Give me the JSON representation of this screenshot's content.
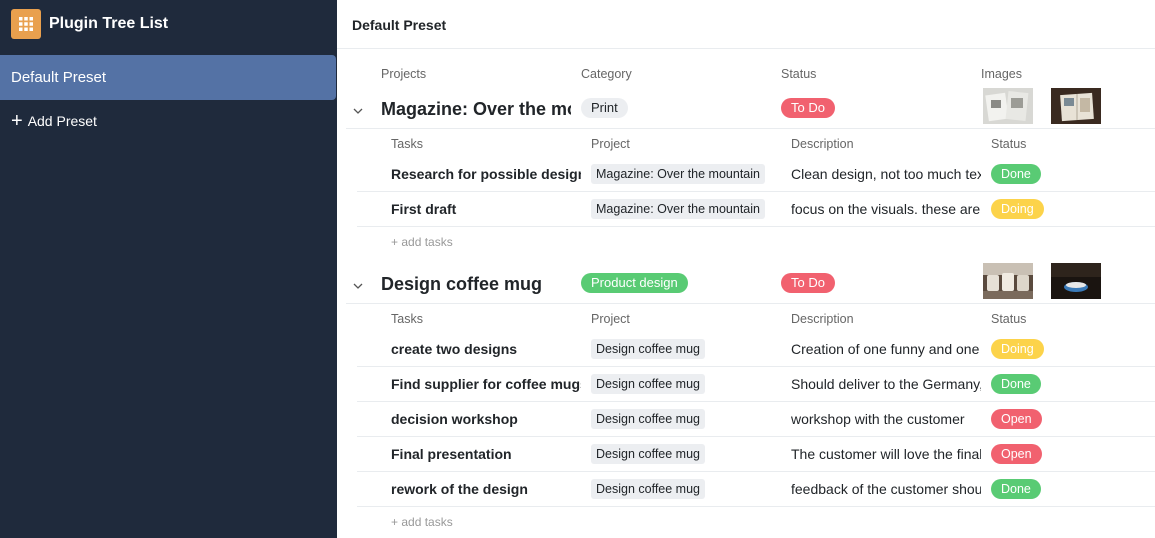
{
  "app": {
    "title": "Plugin Tree List",
    "logo_icon": "grid-icon",
    "logo_color": "#e9a04e"
  },
  "sidebar": {
    "presets": [
      {
        "label": "Default Preset",
        "active": true
      }
    ],
    "add_preset_label": "Add Preset"
  },
  "main": {
    "title": "Default Preset",
    "project_columns": [
      "Projects",
      "Category",
      "Status",
      "Images"
    ],
    "task_columns": [
      "Tasks",
      "Project",
      "Description",
      "Status"
    ],
    "add_tasks_label": "+ add tasks"
  },
  "colors": {
    "done": "#59cb74",
    "doing": "#fcd34a",
    "open": "#f1616f",
    "todo": "#f1616f",
    "print_bg": "#eceef1",
    "product_design": "#59cb74"
  },
  "projects": [
    {
      "name": "Magazine: Over the mountain",
      "category": "Print",
      "status": "To Do",
      "tasks": [
        {
          "name": "Research for possible designs",
          "project": "Magazine: Over the mountain",
          "description": "Clean design, not too much text",
          "status": "Done"
        },
        {
          "name": "First draft",
          "project": "Magazine: Over the mountain",
          "description": "focus on the visuals. these are",
          "status": "Doing"
        }
      ]
    },
    {
      "name": "Design coffee mug",
      "category": "Product design",
      "status": "To Do",
      "tasks": [
        {
          "name": "create two designs",
          "project": "Design coffee mug",
          "description": "Creation of one funny and one",
          "status": "Doing"
        },
        {
          "name": "Find supplier for coffee mugs",
          "project": "Design coffee mug",
          "description": "Should deliver to the Germany,",
          "status": "Done"
        },
        {
          "name": "decision workshop",
          "project": "Design coffee mug",
          "description": "workshop with the customer",
          "status": "Open"
        },
        {
          "name": "Final presentation",
          "project": "Design coffee mug",
          "description": "The customer will love the final",
          "status": "Open"
        },
        {
          "name": "rework of the design",
          "project": "Design coffee mug",
          "description": "feedback of the customer should",
          "status": "Done"
        }
      ]
    }
  ]
}
